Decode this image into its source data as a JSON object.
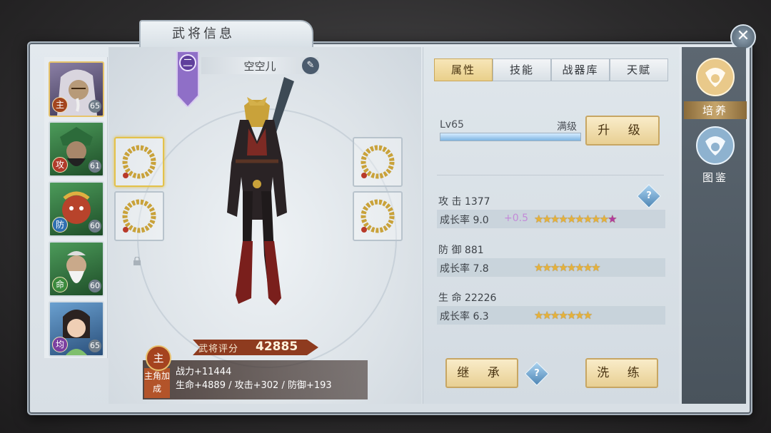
{
  "window": {
    "title": "武将信息",
    "close_icon": "close-icon"
  },
  "roster": [
    {
      "badge": "主",
      "badge_color": "#a3451e",
      "level": "65",
      "face": "silver-hair-general"
    },
    {
      "badge": "攻",
      "badge_color": "#b03a2a",
      "level": "61",
      "face": "green-armor-general"
    },
    {
      "badge": "防",
      "badge_color": "#2f6fb0",
      "level": "60",
      "face": "red-face-general"
    },
    {
      "badge": "命",
      "badge_color": "#3b8a3d",
      "level": "60",
      "face": "old-strategist"
    },
    {
      "badge": "均",
      "badge_color": "#7b3fa0",
      "level": "65",
      "face": "lady-general"
    }
  ],
  "hero": {
    "rank": "二",
    "name": "空空儿",
    "score_label": "武将评分",
    "score": "42885"
  },
  "bonus": {
    "badge": "主",
    "tag": "主角加成",
    "power": "战力+11444",
    "stats": "生命+4889 / 攻击+302 / 防御+193"
  },
  "tabs": [
    "属性",
    "技能",
    "战器库",
    "天赋"
  ],
  "active_tab": 0,
  "level": {
    "text": "Lv65",
    "max": "满级",
    "exp_fraction": 1.0,
    "upgrade_label": "升  级"
  },
  "stats": [
    {
      "label": "攻  击",
      "value": "1377",
      "growth_label": "成长率",
      "growth": "9.0",
      "bonus": "+0.5",
      "stars": 10,
      "purple_star": true
    },
    {
      "label": "防  御",
      "value": "881",
      "growth_label": "成长率",
      "growth": "7.8",
      "bonus": "",
      "stars": 8,
      "purple_star": false
    },
    {
      "label": "生  命",
      "value": "22226",
      "growth_label": "成长率",
      "growth": "6.3",
      "bonus": "",
      "stars": 7,
      "purple_star": false
    }
  ],
  "buttons": {
    "inherit": "继  承",
    "refine": "洗  练",
    "help": "?"
  },
  "side_nav": [
    {
      "label": "培养",
      "icon": "dragon-emblem-icon",
      "active": true
    },
    {
      "label": "图鉴",
      "icon": "dragon-ring-icon",
      "active": false
    }
  ],
  "colors": {
    "gold": "#e8cf93",
    "accent": "#c9a75a",
    "star": "#e6b23a",
    "purple": "#b23aa0"
  }
}
